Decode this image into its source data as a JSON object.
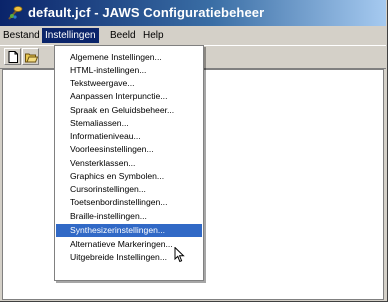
{
  "window": {
    "title": "default.jcf - JAWS Configuratiebeheer"
  },
  "menubar": {
    "items": [
      {
        "label": "Bestand"
      },
      {
        "label": "Instellingen"
      },
      {
        "label": "Beeld"
      },
      {
        "label": "Help"
      }
    ],
    "active": "Instellingen"
  },
  "toolbar": {
    "icons": [
      "new-file-icon",
      "open-folder-icon"
    ]
  },
  "dropdown": {
    "items": [
      {
        "label": "Algemene Instellingen..."
      },
      {
        "label": "HTML-instellingen..."
      },
      {
        "label": "Tekstweergave..."
      },
      {
        "label": "Aanpassen Interpunctie..."
      },
      {
        "label": "Spraak en Geluidsbeheer..."
      },
      {
        "label": "Stemaliassen..."
      },
      {
        "label": "Informatieniveau..."
      },
      {
        "label": "Voorleesinstellingen..."
      },
      {
        "label": "Vensterklassen..."
      },
      {
        "label": "Graphics en Symbolen..."
      },
      {
        "label": "Cursorinstellingen..."
      },
      {
        "label": "Toetsenbordinstellingen..."
      },
      {
        "label": "Braille-instellingen..."
      },
      {
        "label": "Synthesizerinstellingen..."
      },
      {
        "label": "Alternatieve Markeringen..."
      },
      {
        "label": "Uitgebreide Instellingen..."
      }
    ],
    "highlighted_index": 13
  },
  "colors": {
    "title_start": "#0a246a",
    "title_end": "#a6caf0",
    "highlight": "#3169c6",
    "face": "#d4d0c8"
  }
}
